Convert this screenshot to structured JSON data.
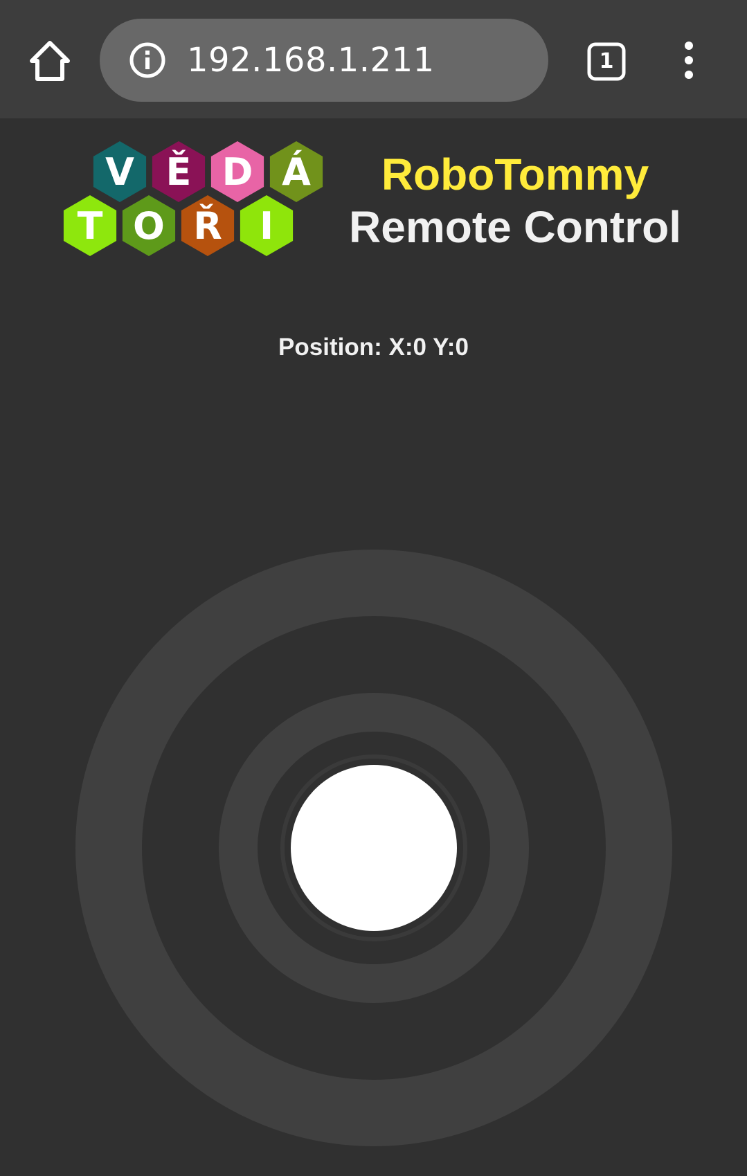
{
  "browser": {
    "url": "192.168.1.211",
    "tab_count": "1",
    "icons": [
      "home-icon",
      "info-icon",
      "tab-switcher-icon",
      "more-vert-icon"
    ]
  },
  "header": {
    "logo_rows": [
      [
        "V",
        "Ě",
        "D",
        "Á"
      ],
      [
        "T",
        "O",
        "Ř",
        "I"
      ]
    ],
    "logo_colors": {
      "V": "#13686a",
      "Ě": "#8a1256",
      "D": "#e864a6",
      "Á": "#71921b",
      "T": "#8ee70d",
      "O": "#5e9a1a",
      "Ř": "#b6520e",
      "I": "#8fe50b"
    },
    "title": "RoboTommy",
    "subtitle": "Remote Control"
  },
  "position": {
    "label": "Position:",
    "x_label": "X:",
    "x": "0",
    "y_label": "Y:",
    "y": "0"
  },
  "colors": {
    "background": "#303030",
    "toolbar": "#3d3d3d",
    "address_bar": "#686868",
    "title_accent": "#ffeb3b",
    "ring": "#404040",
    "knob": "#ffffff"
  }
}
